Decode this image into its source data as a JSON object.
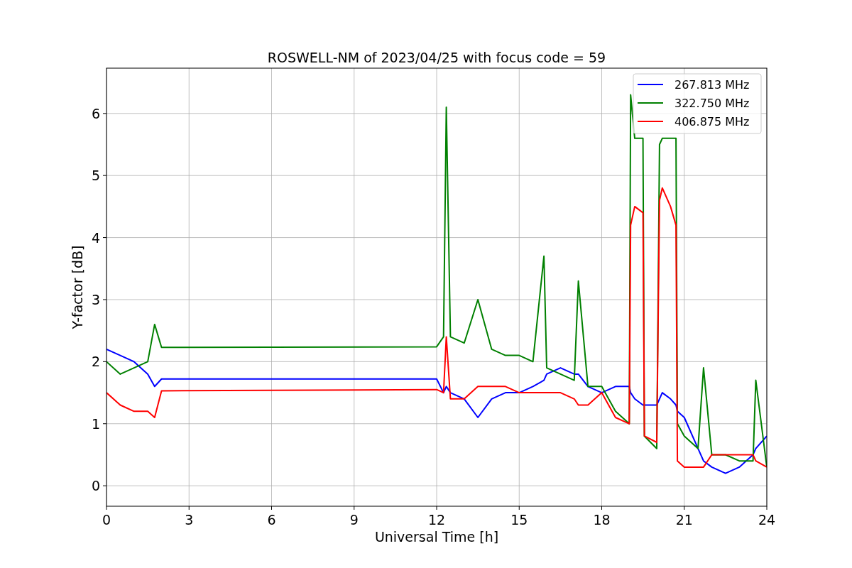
{
  "figure": {
    "chart_data": {
      "type": "line",
      "title": "ROSWELL-NM of 2023/04/25 with focus code = 59",
      "xlabel": "Universal Time [h]",
      "ylabel": "Y-factor [dB]",
      "xlim": [
        0,
        24
      ],
      "ylim": [
        -0.33,
        6.73
      ],
      "grid": true,
      "legend": true,
      "xticks": [
        0,
        3,
        6,
        9,
        12,
        15,
        18,
        21,
        24
      ],
      "yticks": [
        0,
        1,
        2,
        3,
        4,
        5,
        6
      ],
      "x": [
        0,
        0.5,
        1,
        1.5,
        1.75,
        2,
        12,
        12.25,
        12.35,
        12.5,
        13,
        13.5,
        14,
        14.5,
        15,
        15.5,
        15.9,
        16,
        16.5,
        17,
        17.15,
        17.5,
        18,
        18.5,
        19,
        19.05,
        19.2,
        19.5,
        19.55,
        20,
        20.1,
        20.2,
        20.5,
        20.7,
        20.75,
        21,
        21.5,
        21.7,
        22,
        22.5,
        23,
        23.5,
        23.6,
        24
      ],
      "series": [
        {
          "name": "267.813 MHz",
          "color": "#0000ff",
          "values": [
            2.2,
            2.1,
            2.0,
            1.8,
            1.6,
            1.72,
            1.72,
            1.5,
            1.6,
            1.5,
            1.4,
            1.1,
            1.4,
            1.5,
            1.5,
            1.6,
            1.7,
            1.8,
            1.9,
            1.8,
            1.8,
            1.6,
            1.5,
            1.6,
            1.6,
            1.5,
            1.4,
            1.3,
            1.3,
            1.3,
            1.4,
            1.5,
            1.4,
            1.3,
            1.2,
            1.1,
            0.6,
            0.4,
            0.3,
            0.2,
            0.3,
            0.5,
            0.6,
            0.8
          ]
        },
        {
          "name": "322.750 MHz",
          "color": "#008000",
          "values": [
            2.0,
            1.8,
            1.9,
            2.0,
            2.6,
            2.23,
            2.24,
            2.4,
            6.1,
            2.4,
            2.3,
            3.0,
            2.2,
            2.1,
            2.1,
            2.0,
            3.7,
            1.9,
            1.8,
            1.7,
            3.3,
            1.6,
            1.6,
            1.2,
            1.0,
            6.3,
            5.6,
            5.6,
            0.8,
            0.6,
            5.5,
            5.6,
            5.6,
            5.6,
            1.0,
            0.8,
            0.6,
            1.9,
            0.5,
            0.5,
            0.4,
            0.4,
            1.7,
            0.3
          ]
        },
        {
          "name": "406.875 MHz",
          "color": "#ff0000",
          "values": [
            1.5,
            1.3,
            1.2,
            1.2,
            1.1,
            1.53,
            1.55,
            1.5,
            2.4,
            1.4,
            1.4,
            1.6,
            1.6,
            1.6,
            1.5,
            1.5,
            1.5,
            1.5,
            1.5,
            1.4,
            1.3,
            1.3,
            1.5,
            1.1,
            1.0,
            4.2,
            4.5,
            4.4,
            0.8,
            0.7,
            4.6,
            4.8,
            4.5,
            4.2,
            0.4,
            0.3,
            0.3,
            0.3,
            0.5,
            0.5,
            0.5,
            0.5,
            0.4,
            0.3
          ]
        }
      ]
    }
  }
}
